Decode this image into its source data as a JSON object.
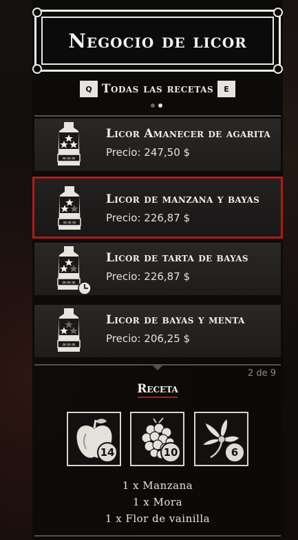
{
  "header": {
    "title": "Negocio de licor"
  },
  "category": {
    "prev_key": "Q",
    "next_key": "E",
    "label": "Todas las recetas"
  },
  "pager": {
    "pages": 2,
    "active_index": 1
  },
  "items": [
    {
      "name": "Licor Amanecer de agarita",
      "price_label": "Precio:",
      "price": "247,50 $",
      "stars": 3,
      "timer": false
    },
    {
      "name": "Licor de manzana y bayas",
      "price_label": "Precio:",
      "price": "226,87 $",
      "stars": 2,
      "timer": false
    },
    {
      "name": "Licor de tarta de bayas",
      "price_label": "Precio:",
      "price": "226,87 $",
      "stars": 2,
      "timer": true
    },
    {
      "name": "Licor de bayas y menta",
      "price_label": "Precio:",
      "price": "206,25 $",
      "stars": 1,
      "timer": false
    }
  ],
  "selected_index": 1,
  "list_position": "2 de 9",
  "recipe": {
    "title": "Receta",
    "ingredients": [
      {
        "icon": "apple-icon",
        "count": "14"
      },
      {
        "icon": "blackberry-icon",
        "count": "10"
      },
      {
        "icon": "vanilla-flower-icon",
        "count": "6"
      }
    ],
    "requirements": [
      "1 x Manzana",
      "1 x Mora",
      "1 x Flor de vainilla"
    ]
  },
  "colors": {
    "selection": "#b01b1b",
    "panel": "#1f1d1c",
    "text": "#f2efe9"
  }
}
